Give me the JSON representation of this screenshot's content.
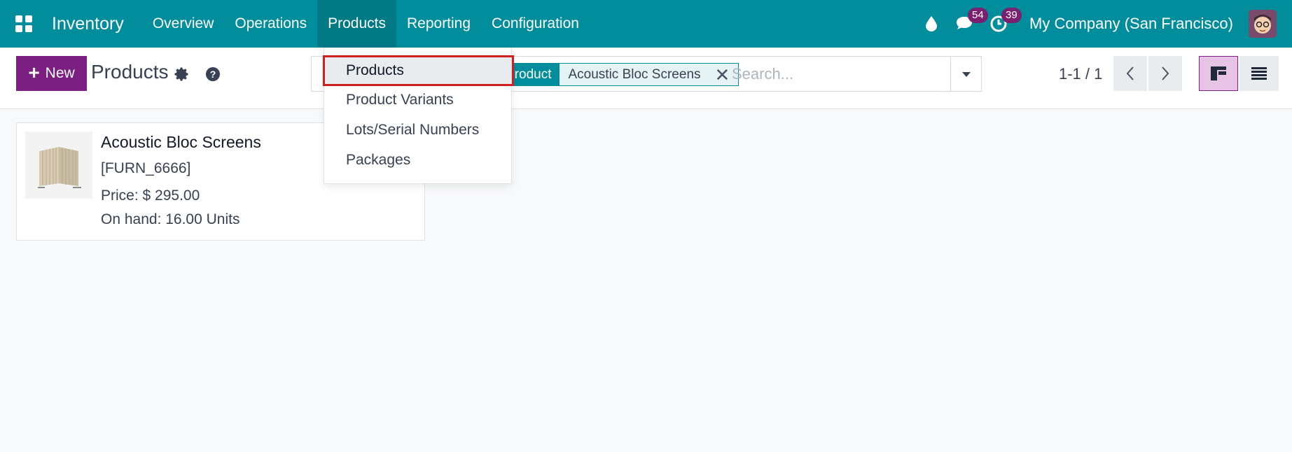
{
  "navbar": {
    "app_name": "Inventory",
    "menu": [
      "Overview",
      "Operations",
      "Products",
      "Reporting",
      "Configuration"
    ],
    "messages_count": "54",
    "activities_count": "39",
    "company": "My Company (San Francisco)"
  },
  "control": {
    "new_label": "New",
    "title": "Products",
    "facet_label": "Product",
    "facet_value": "Acoustic Bloc Screens",
    "search_placeholder": "Search...",
    "pager": "1-1 / 1"
  },
  "card": {
    "name": "Acoustic Bloc Screens",
    "ref": "[FURN_6666]",
    "price": "Price: $ 295.00",
    "on_hand": "On hand: 16.00 Units"
  },
  "dropdown": {
    "items": [
      "Products",
      "Product Variants",
      "Lots/Serial Numbers",
      "Packages"
    ]
  },
  "colors": {
    "navbar": "#018d9b",
    "primary_button": "#7b1f82",
    "badge": "#7b1f6f",
    "highlight_border": "#d01f1f"
  }
}
